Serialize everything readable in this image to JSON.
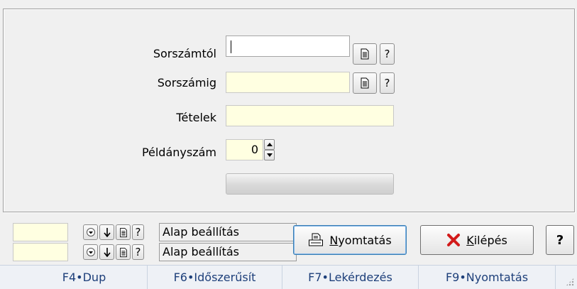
{
  "form": {
    "from_label": "Sorszámtól",
    "to_label": "Sorszámig",
    "items_label": "Tételek",
    "copies_label": "Példányszám",
    "copies_value": "0",
    "from_value": "",
    "to_value": "",
    "items_value": "",
    "progress": 0
  },
  "settings_rows": [
    {
      "value": "",
      "label": "Alap beállítás"
    },
    {
      "value": "",
      "label": "Alap beállítás"
    }
  ],
  "buttons": {
    "print_first": "N",
    "print_rest": "yomtatás",
    "exit_first": "K",
    "exit_rest": "ilépés",
    "help": "?",
    "lookup_q": "?"
  },
  "statusbar": [
    {
      "label": "F4•Dup"
    },
    {
      "label": "F6•Időszerűsít"
    },
    {
      "label": "F7•Lekérdezés"
    },
    {
      "label": "F9•Nyomtatás"
    }
  ],
  "icons": {
    "doc": "document-icon",
    "dropdown": "dropdown-arrow-icon",
    "down": "down-arrow-icon",
    "printer": "printer-icon",
    "close": "red-x-icon",
    "grip": "resize-grip-icon"
  },
  "colors": {
    "readonly_field": "#ffffe1",
    "exit_icon": "#d21a1a",
    "status_text": "#1d3f7a"
  }
}
